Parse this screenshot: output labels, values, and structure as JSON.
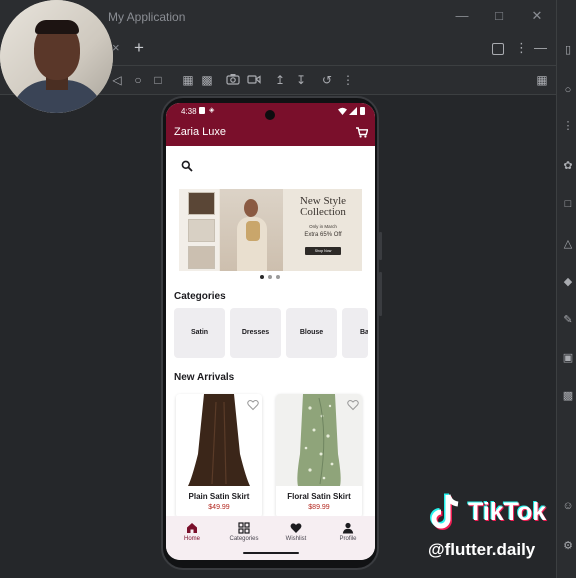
{
  "window": {
    "title": "My Application",
    "controls": [
      "minimize-icon",
      "maximize-icon",
      "close-icon"
    ]
  },
  "tabbar": {
    "tab_close": "×",
    "add_tab": "+"
  },
  "toolbar": {
    "icons": [
      "back-icon",
      "home-icon",
      "overview-icon",
      "device-settings-icon",
      "device-icon",
      "camera-icon",
      "video-icon",
      "upload-icon",
      "download-icon",
      "rotate-icon",
      "more-icon"
    ]
  },
  "phone": {
    "status": {
      "time": "4:38"
    },
    "appbar": {
      "title": "Zaria Luxe",
      "cart_icon": "cart-icon"
    },
    "search_icon": "search-icon",
    "banner": {
      "title": "New Style Collection",
      "small_text": "Only in March",
      "offer": "Extra 65% Off",
      "button": "Shop Now"
    },
    "carousel_dots": {
      "count": 3,
      "active": 0
    },
    "categories": {
      "title": "Categories",
      "items": [
        "Satin",
        "Dresses",
        "Blouse",
        "Ba"
      ]
    },
    "new_arrivals": {
      "title": "New Arrivals",
      "products": [
        {
          "name": "Plain Satin Skirt",
          "price": "$49.99"
        },
        {
          "name": "Floral Satin Skirt",
          "price": "$89.99"
        }
      ]
    },
    "bottom_nav": [
      {
        "label": "Home",
        "icon": "home-icon",
        "active": true
      },
      {
        "label": "Categories",
        "icon": "grid-icon",
        "active": false
      },
      {
        "label": "Wishlist",
        "icon": "heart-icon",
        "active": false
      },
      {
        "label": "Profile",
        "icon": "person-icon",
        "active": false
      }
    ]
  },
  "watermark": {
    "brand": "TikTok",
    "handle": "@flutter.daily"
  },
  "colors": {
    "brand": "#7a0f2b",
    "price": "#b3261e",
    "nav_bg": "#f6eef2",
    "ide_bg": "#2b2d30"
  }
}
